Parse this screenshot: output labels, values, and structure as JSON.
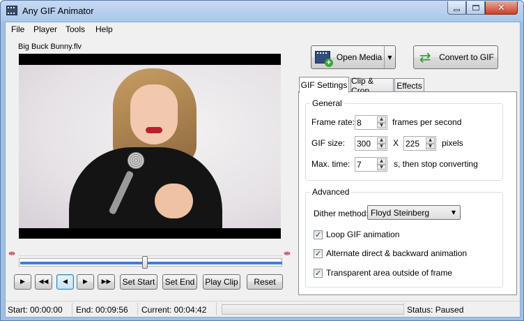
{
  "window": {
    "title": "Any GIF Animator",
    "min_symbol": "—",
    "close_symbol": "✕"
  },
  "menu": [
    "File",
    "Player",
    "Tools",
    "Help"
  ],
  "player": {
    "file_name": "Big Buck Bunny.flv",
    "seek_position": 0.48,
    "buttons": {
      "play": "▶",
      "skip_back": "◀◀",
      "step_back": "◀",
      "step_forward": "▶",
      "skip_forward": "▶▶",
      "set_start": "Set Start",
      "set_end": "Set End",
      "play_clip": "Play Clip",
      "reset": "Reset"
    }
  },
  "actions": {
    "open_media": "Open Media",
    "convert": "Convert to GIF"
  },
  "tabs": [
    "GIF Settings",
    "Clip & Crop",
    "Effects"
  ],
  "general": {
    "title": "General",
    "frame_rate_label": "Frame rate:",
    "frame_rate": "8",
    "frame_rate_unit": "frames per second",
    "gif_size_label": "GIF size:",
    "width": "300",
    "times": "X",
    "height": "225",
    "size_unit": "pixels",
    "max_time_label": "Max. time:",
    "max_time": "7",
    "max_time_unit": "s, then stop converting"
  },
  "advanced": {
    "title": "Advanced",
    "dither_label": "Dither method:",
    "dither_value": "Floyd Steinberg",
    "loop": "Loop GIF animation",
    "alternate": "Alternate direct & backward animation",
    "transparent": "Transparent area outside of frame",
    "loop_checked": true,
    "alternate_checked": true,
    "transparent_checked": true
  },
  "status": {
    "start": "Start: 00:00:00",
    "end": "End: 00:09:56",
    "current": "Current: 00:04:42",
    "progress": 0,
    "state": "Status: Paused"
  },
  "colors": {
    "accent": "#3d7fd4",
    "marker": "#c4304a",
    "progress": "#06b025"
  }
}
